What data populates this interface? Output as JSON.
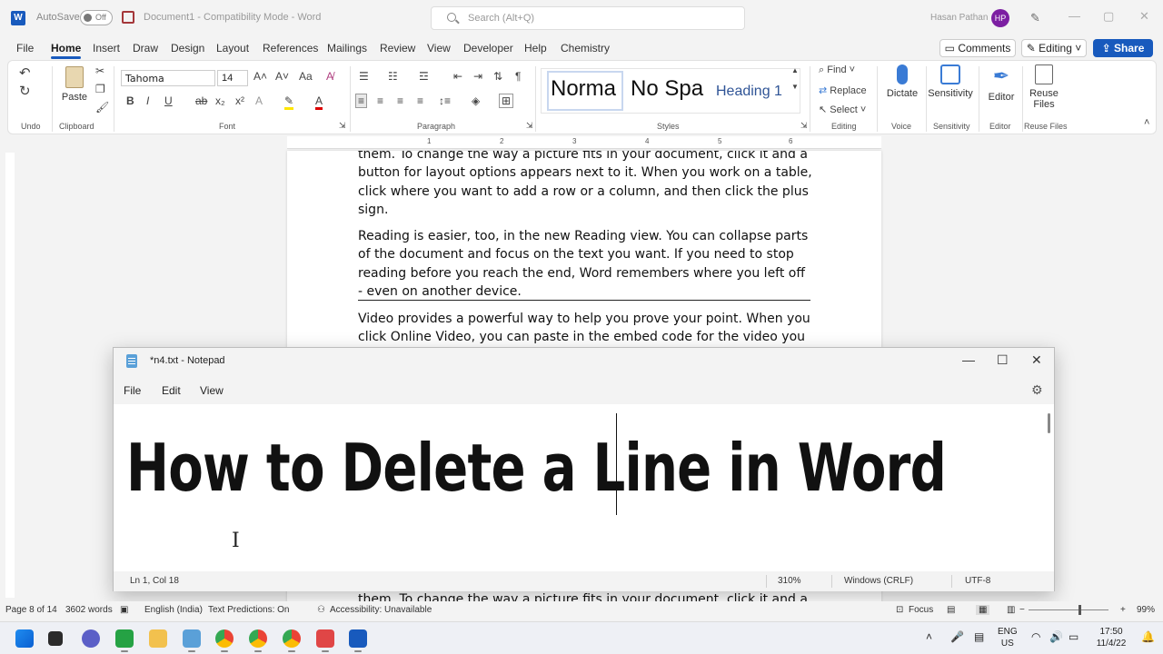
{
  "word": {
    "app_logo": "W",
    "autosave_label": "AutoSave",
    "autosave_state": "Off",
    "doc_title": "Document1  -  Compatibility Mode  -  Word",
    "search_placeholder": "Search (Alt+Q)",
    "user_name": "Hasan Pathan",
    "user_initials": "HP",
    "tabs": [
      "File",
      "Home",
      "Insert",
      "Draw",
      "Design",
      "Layout",
      "References",
      "Mailings",
      "Review",
      "View",
      "Developer",
      "Help",
      "Chemistry"
    ],
    "active_tab": "Home",
    "comments_label": "Comments",
    "editing_label": "Editing",
    "share_label": "Share",
    "ribbon": {
      "groups": [
        "Undo",
        "Clipboard",
        "Font",
        "Paragraph",
        "Styles",
        "Editing",
        "Voice",
        "Sensitivity",
        "Editor",
        "Reuse Files"
      ],
      "paste_label": "Paste",
      "font_name": "Tahoma",
      "font_size": "14",
      "styles": [
        "Norma",
        "No Spa",
        "Heading 1"
      ],
      "find_label": "Find",
      "replace_label": "Replace",
      "select_label": "Select",
      "dictate_label": "Dictate",
      "sensitivity_label": "Sensitivity",
      "editor_label": "Editor",
      "reuse_files_label": "Reuse Files"
    },
    "document": {
      "para1": "them. To change the way a picture fits in your document, click it and a button for layout options appears next to it. When you work on a table, click where you want to add a row or a column, and then click the plus sign.",
      "para2": "Reading is easier, too, in the new Reading view. You can collapse parts of the document and focus on the text you want. If you need to stop reading before you reach the end, Word remembers where you left off - even on another device.",
      "para3": "Video provides a powerful way to help you prove your point. When you click Online Video, you can paste in the embed code for the video you",
      "para4": "them. To change the way a picture fits in your document, click it and a"
    },
    "status": {
      "page": "Page 8 of 14",
      "words": "3602 words",
      "language": "English (India)",
      "predictions": "Text Predictions: On",
      "accessibility": "Accessibility: Unavailable",
      "focus": "Focus",
      "zoom": "99%"
    }
  },
  "notepad": {
    "title": "*n4.txt - Notepad",
    "menus": [
      "File",
      "Edit",
      "View"
    ],
    "content": "How to Delete a Line in Word",
    "status": {
      "position": "Ln 1, Col 18",
      "zoom": "310%",
      "line_ending": "Windows (CRLF)",
      "encoding": "UTF-8"
    }
  },
  "taskbar": {
    "language": "ENG",
    "region": "US",
    "time": "17:50",
    "date": "11/4/22"
  }
}
